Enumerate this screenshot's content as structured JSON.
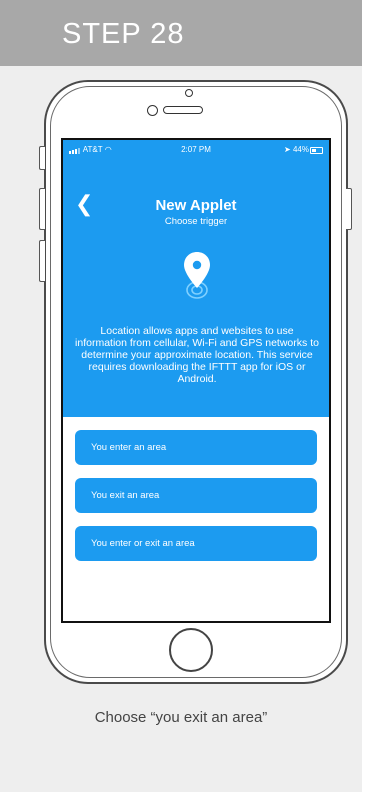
{
  "step": {
    "title": "STEP 28"
  },
  "status_bar": {
    "carrier": "AT&T",
    "time": "2:07 PM",
    "battery": "44%"
  },
  "applet": {
    "title": "New Applet",
    "subtitle": "Choose trigger",
    "icon": "location-pin-icon",
    "description": "Location allows apps and websites to use information from cellular, Wi-Fi and GPS networks to determine your approximate location. This service requires downloading the IFTTT app for iOS or Android."
  },
  "triggers": [
    {
      "label": "You enter an area"
    },
    {
      "label": "You exit an area"
    },
    {
      "label": "You enter or exit an area"
    }
  ],
  "caption": "Choose “you exit an area”",
  "colors": {
    "accent": "#1c9bf0",
    "header": "#a8a8a8",
    "card": "#eeeeee"
  }
}
